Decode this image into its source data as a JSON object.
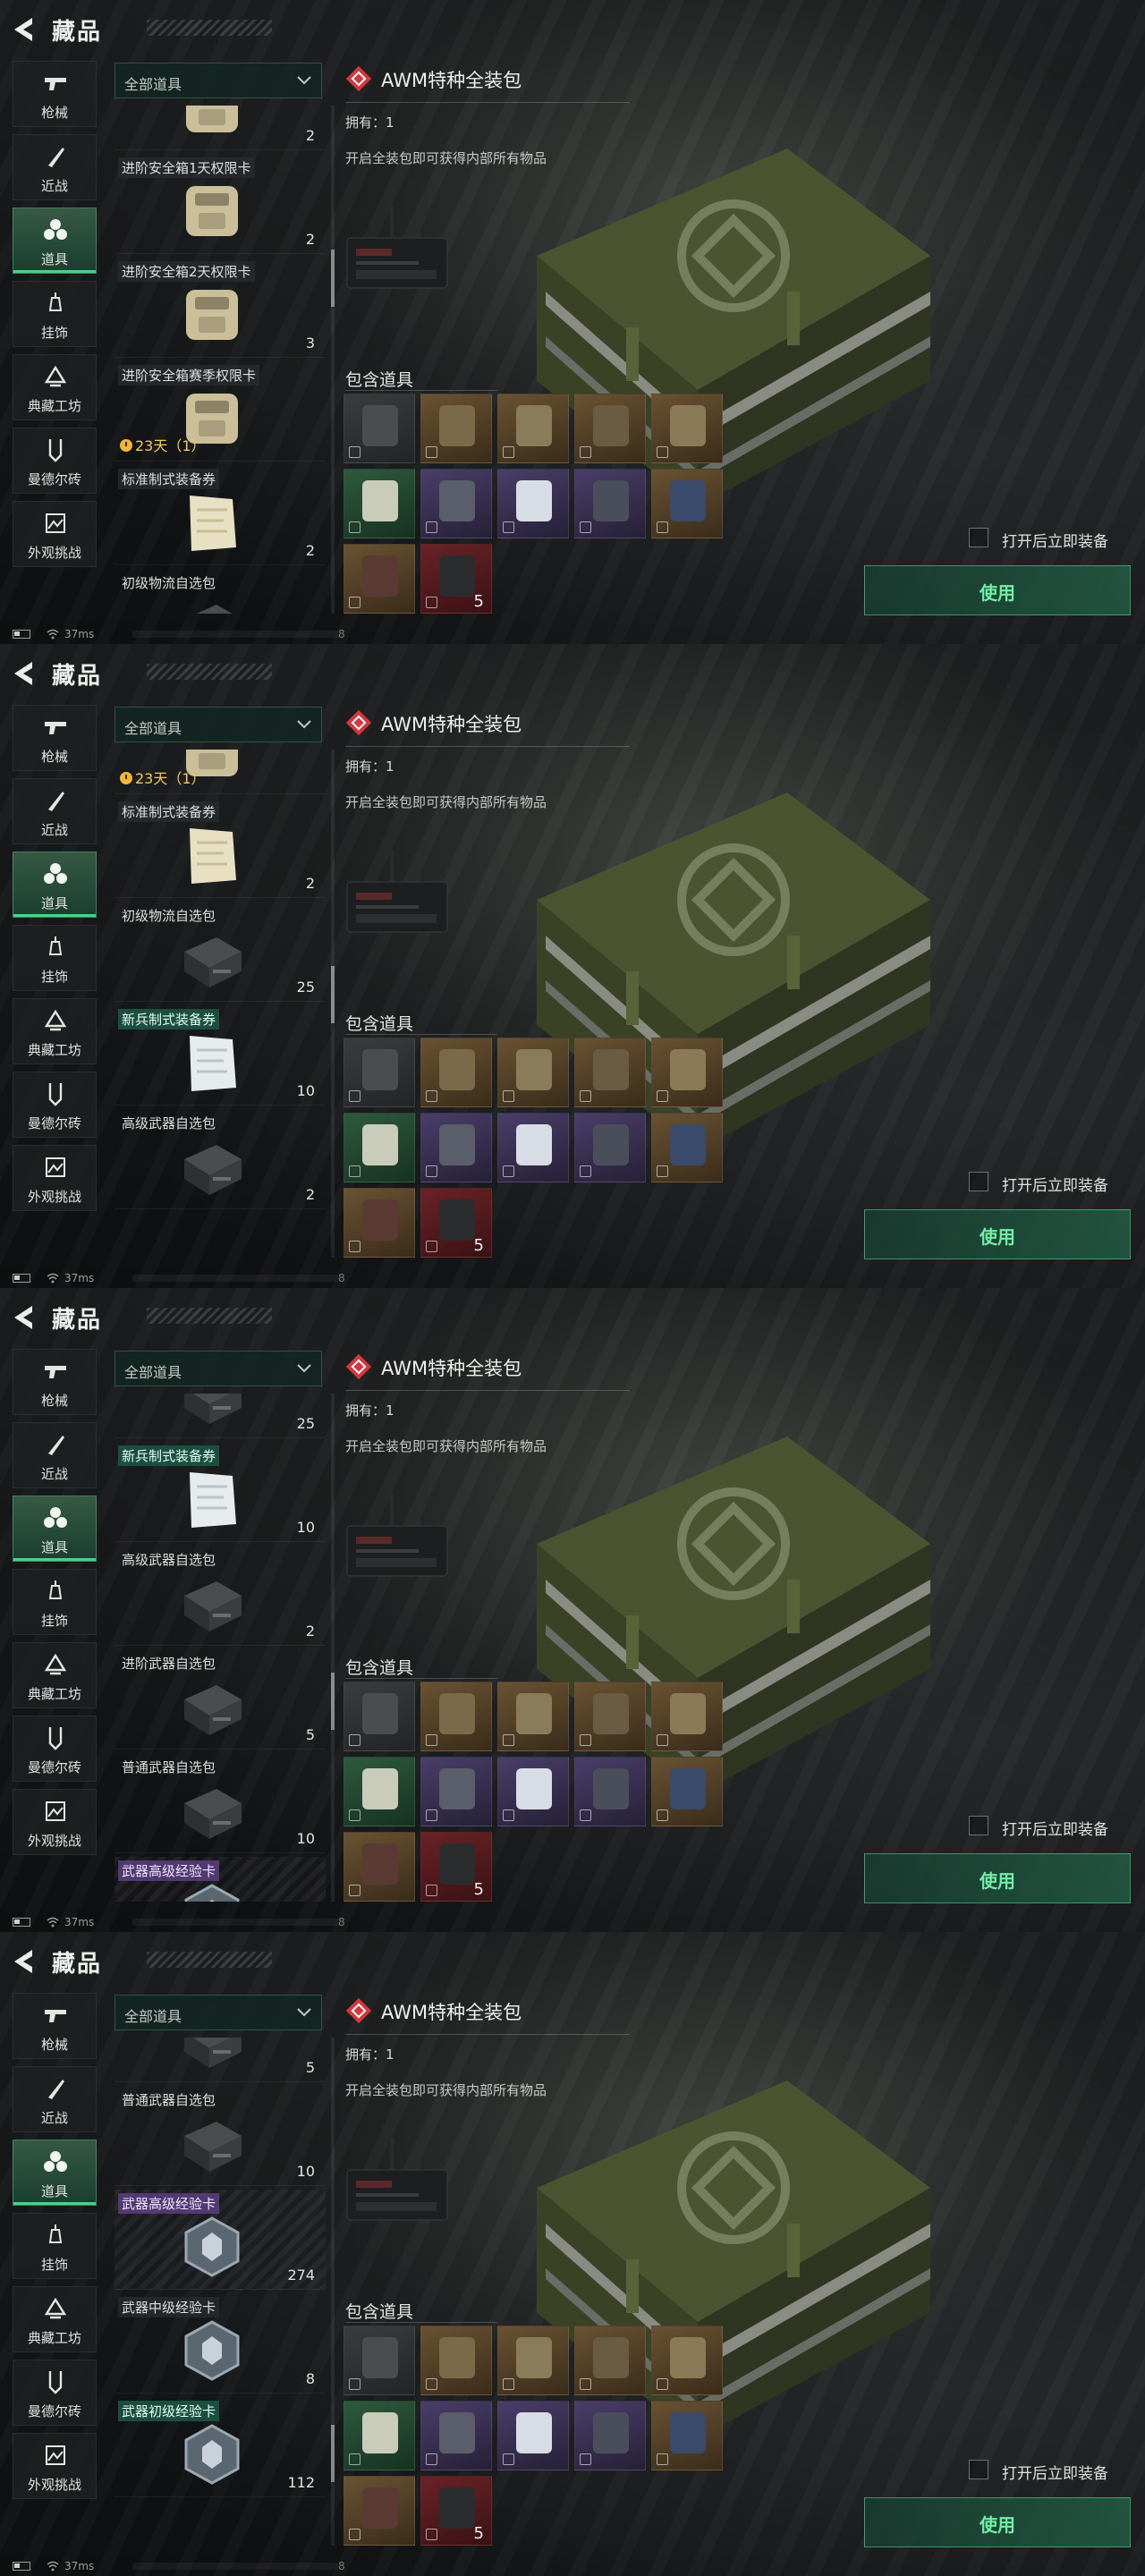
{
  "header": {
    "title": "藏品"
  },
  "nav": [
    {
      "label": "枪械",
      "icon": "gun-icon"
    },
    {
      "label": "近战",
      "icon": "knife-icon"
    },
    {
      "label": "道具",
      "icon": "items-icon",
      "active": true
    },
    {
      "label": "挂饰",
      "icon": "charm-icon"
    },
    {
      "label": "典藏工坊",
      "icon": "workshop-icon"
    },
    {
      "label": "曼德尔砖",
      "icon": "mandel-brick-icon"
    },
    {
      "label": "外观挑战",
      "icon": "appearance-challenge-icon"
    }
  ],
  "filter": {
    "selected": "全部道具"
  },
  "detail": {
    "title": "AWM特种全装包",
    "owned": "拥有：1",
    "description": "开启全装包即可获得内部所有物品",
    "contents_label": "包含道具",
    "contents": [
      {
        "rarity": "gray",
        "thing": "rifle"
      },
      {
        "rarity": "gold",
        "thing": "backpack"
      },
      {
        "rarity": "gold",
        "thing": "vest"
      },
      {
        "rarity": "gold",
        "thing": "helmet"
      },
      {
        "rarity": "gold",
        "thing": "armor"
      },
      {
        "rarity": "green",
        "thing": "syringe"
      },
      {
        "rarity": "purple",
        "thing": "magazine"
      },
      {
        "rarity": "purple",
        "thing": "bandage"
      },
      {
        "rarity": "purple",
        "thing": "ammo-box"
      },
      {
        "rarity": "gold",
        "thing": "battery"
      },
      {
        "rarity": "gold",
        "thing": "medkit"
      },
      {
        "rarity": "red",
        "thing": "case",
        "count": "5"
      }
    ],
    "equip_label": "打开后立即装备",
    "use_label": "使用"
  },
  "status": {
    "ping": "37ms",
    "num": "8"
  },
  "frames": [
    {
      "scroll_thumb": 0.32,
      "items": [
        {
          "label": "",
          "count": "2",
          "icon": "safe-box-icon",
          "offset": -62
        },
        {
          "label": "进阶安全箱1天权限卡",
          "count": "2",
          "icon": "safe-box-icon",
          "offset": 54
        },
        {
          "label": "进阶安全箱2天权限卡",
          "count": "3",
          "icon": "safe-box-icon",
          "offset": 170
        },
        {
          "label": "进阶安全箱赛季权限卡",
          "timer": "23天（1）",
          "icon": "safe-box-icon",
          "offset": 286
        },
        {
          "label": "标准制式装备券",
          "count": "2",
          "icon": "voucher-icon",
          "style": "blue",
          "offset": 402
        },
        {
          "label": "初级物流自选包",
          "icon": "crate-icon",
          "style": "plain",
          "offset": 518
        }
      ]
    },
    {
      "scroll_thumb": 0.48,
      "items": [
        {
          "label": "进阶安全箱赛季权限卡",
          "timer": "23天（1）",
          "icon": "safe-box-icon",
          "offset": -62
        },
        {
          "label": "标准制式装备券",
          "count": "2",
          "icon": "voucher-icon",
          "style": "blue",
          "offset": 54
        },
        {
          "label": "初级物流自选包",
          "count": "25",
          "icon": "crate-icon",
          "style": "plain",
          "offset": 170
        },
        {
          "label": "新兵制式装备券",
          "count": "10",
          "icon": "voucher-white-icon",
          "style": "green",
          "offset": 286
        },
        {
          "label": "高级武器自选包",
          "count": "2",
          "icon": "crate-icon",
          "style": "plain",
          "offset": 402
        }
      ]
    },
    {
      "scroll_thumb": 0.62,
      "items": [
        {
          "label": "",
          "count": "25",
          "icon": "crate-icon",
          "offset": -62
        },
        {
          "label": "新兵制式装备券",
          "count": "10",
          "icon": "voucher-white-icon",
          "style": "green",
          "offset": 54
        },
        {
          "label": "高级武器自选包",
          "count": "2",
          "icon": "crate-icon",
          "style": "plain",
          "offset": 170
        },
        {
          "label": "进阶武器自选包",
          "count": "5",
          "icon": "crate-icon",
          "style": "plain",
          "offset": 286
        },
        {
          "label": "普通武器自选包",
          "count": "10",
          "icon": "crate-icon",
          "style": "plain",
          "offset": 402
        },
        {
          "label": "武器高级经验卡",
          "icon": "exp-card-icon",
          "style": "purple",
          "banded": true,
          "offset": 518
        }
      ]
    },
    {
      "scroll_thumb": 0.86,
      "items": [
        {
          "label": "",
          "count": "5",
          "icon": "crate-icon",
          "offset": -62
        },
        {
          "label": "普通武器自选包",
          "count": "10",
          "icon": "crate-icon",
          "style": "plain",
          "offset": 54
        },
        {
          "label": "武器高级经验卡",
          "count": "274",
          "icon": "exp-card-icon",
          "style": "purple",
          "banded": true,
          "offset": 170
        },
        {
          "label": "武器中级经验卡",
          "count": "8",
          "icon": "exp-card-icon",
          "style": "blue",
          "offset": 286
        },
        {
          "label": "武器初级经验卡",
          "count": "112",
          "icon": "exp-card-icon",
          "style": "green",
          "offset": 402
        }
      ]
    }
  ]
}
